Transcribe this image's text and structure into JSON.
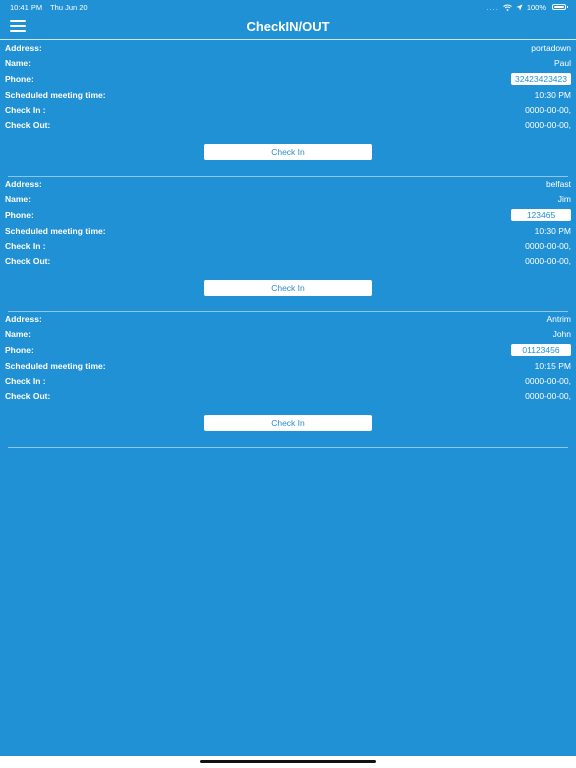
{
  "status_bar": {
    "time": "10:41 PM",
    "date": "Thu Jun 20",
    "signal": "....",
    "battery": "100%"
  },
  "nav": {
    "title": "CheckIN/OUT",
    "menu_icon": "hamburger-menu-icon"
  },
  "labels": {
    "address": "Address:",
    "name": "Name:",
    "phone": "Phone:",
    "scheduled": "Scheduled meeting time:",
    "check_in": "Check In :",
    "check_out": "Check Out:"
  },
  "records": [
    {
      "address": "portadown",
      "name": "Paul",
      "phone": "32423423423",
      "scheduled_time": "10:30 PM",
      "check_in": "0000-00-00,",
      "check_out": "0000-00-00,",
      "button_label": "Check In"
    },
    {
      "address": "belfast",
      "name": "Jim",
      "phone": "123465",
      "scheduled_time": "10:30 PM",
      "check_in": "0000-00-00,",
      "check_out": "0000-00-00,",
      "button_label": "Check In"
    },
    {
      "address": "Antrim",
      "name": "John",
      "phone": "01123456",
      "scheduled_time": "10:15 PM",
      "check_in": "0000-00-00,",
      "check_out": "0000-00-00,",
      "button_label": "Check In"
    }
  ],
  "colors": {
    "background": "#2191d5",
    "text": "#ffffff",
    "button_text": "#2b8ccc"
  }
}
